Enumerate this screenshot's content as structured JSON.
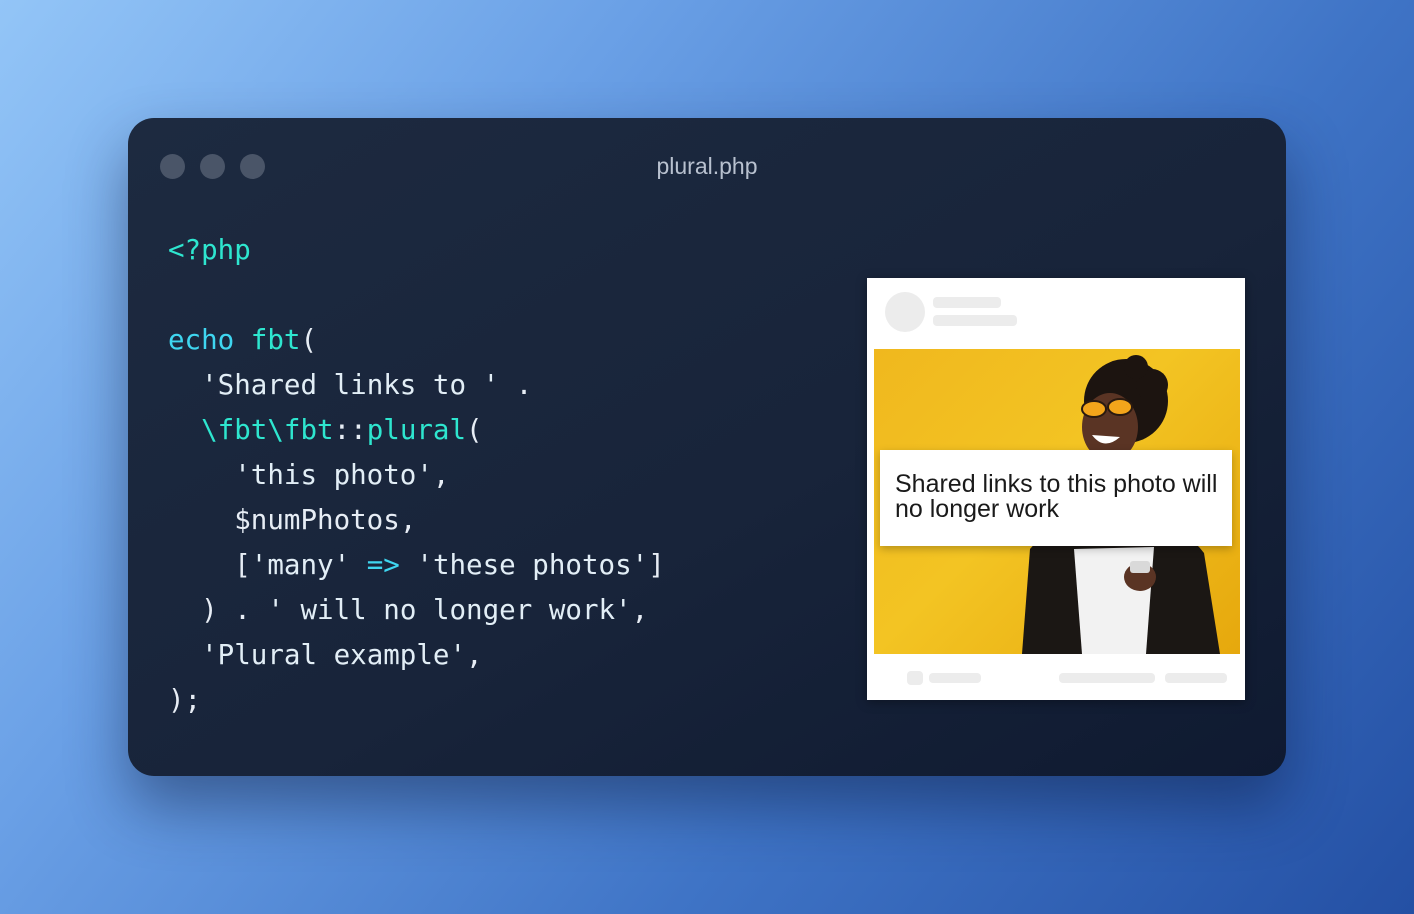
{
  "window": {
    "title": "plural.php",
    "traffic_light_color": "#4a5568"
  },
  "code": {
    "open_tag": "<?php",
    "echo": "echo",
    "fbt_fn": "fbt",
    "paren_open": "(",
    "str_shared": "'Shared links to '",
    "concat": ".",
    "plural_ns": "\\fbt\\fbt",
    "scope": "::",
    "plural_fn": "plural",
    "str_this_photo": "'this photo'",
    "comma": ",",
    "var_num": "$numPhotos",
    "bracket_open": "[",
    "str_many": "'many'",
    "arrow": "=>",
    "str_these": "'these photos'",
    "bracket_close": "]",
    "paren_close": ")",
    "str_will": "' will no longer work'",
    "str_plural": "'Plural example'",
    "terminator": ");"
  },
  "preview": {
    "caption": "Shared links to this photo will no longer work",
    "photo_bg_color": "#f3c423"
  }
}
